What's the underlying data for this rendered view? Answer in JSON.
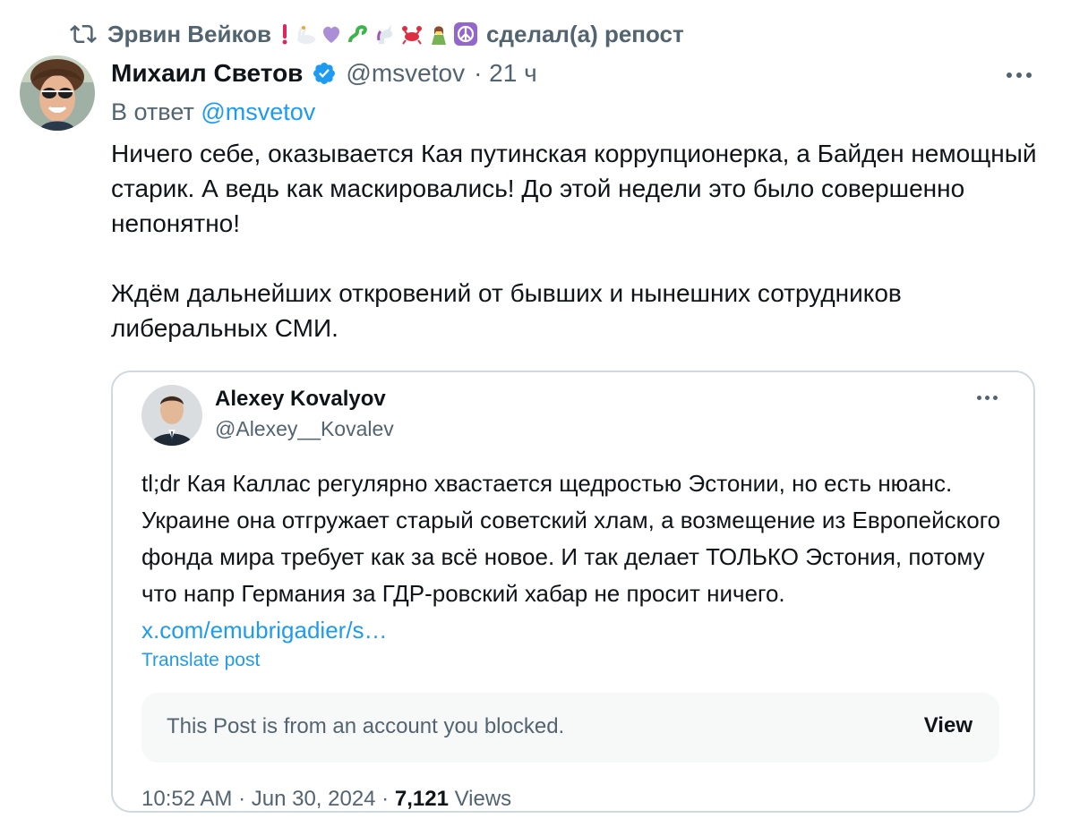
{
  "repost": {
    "user": "Эрвин Вейков",
    "label": "сделал(а) репост"
  },
  "tweet": {
    "author_name": "Михаил Светов",
    "handle": "@msvetov",
    "time": "· 21 ч",
    "reply_prefix": "В ответ",
    "reply_handle": "@msvetov",
    "paragraph1": "Ничего себе, оказывается Кая путинская коррупционерка, а Байден немощный старик. А ведь как маскировались! До этой недели это было совершенно непонятно!",
    "paragraph2": "Ждём дальнейших откровений от бывших и нынешних сотрудников либеральных СМИ."
  },
  "quote": {
    "author_name": "Alexey Kovalyov",
    "handle": "@Alexey__Kovalev",
    "text": "tl;dr Кая Каллас регулярно хвастается щедростью Эстонии, но есть нюанс. Украине она отгружает старый советский хлам, а возмещение из Европейского фонда мира требует как за всё новое. И так делает ТОЛЬКО Эстония, потому что напр Германия за ГДР-ровский хабар не просит ничего.",
    "link": "x.com/emubrigadier/s…",
    "translate": "Translate post",
    "blocked_text": "This Post is from an account you blocked.",
    "blocked_view": "View",
    "meta_time": "10:52 AM · Jun 30, 2024 ·",
    "views_count": "7,121",
    "views_label": "Views"
  },
  "colors": {
    "accent": "#1d9bf0",
    "muted": "#536471",
    "text": "#0f1419",
    "border": "#cfd9de"
  }
}
